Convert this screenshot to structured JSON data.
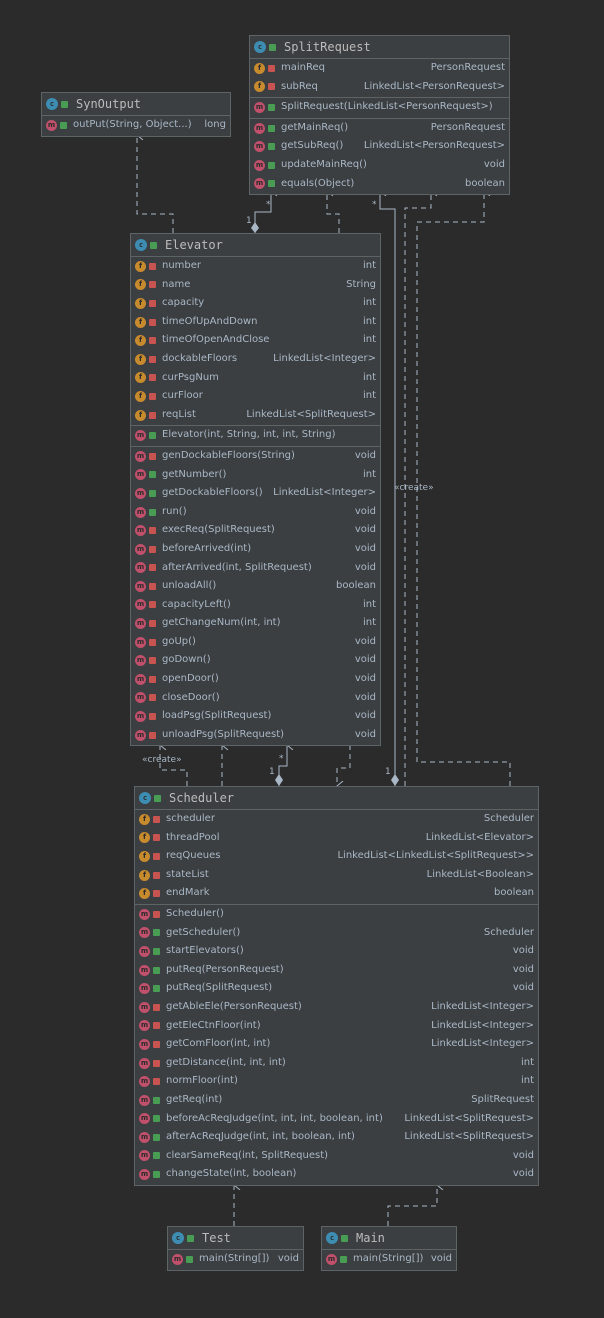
{
  "classes": {
    "splitrequest": {
      "name": "SplitRequest",
      "fields": [
        {
          "name": "mainReq",
          "type": "PersonRequest"
        },
        {
          "name": "subReq",
          "type": "LinkedList<PersonRequest>"
        }
      ],
      "constructors": [
        {
          "name": "SplitRequest(LinkedList<PersonRequest>)",
          "type": ""
        }
      ],
      "methods": [
        {
          "name": "getMainReq()",
          "type": "PersonRequest"
        },
        {
          "name": "getSubReq()",
          "type": "LinkedList<PersonRequest>"
        },
        {
          "name": "updateMainReq()",
          "type": "void"
        },
        {
          "name": "equals(Object)",
          "type": "boolean"
        }
      ]
    },
    "synoutput": {
      "name": "SynOutput",
      "methods": [
        {
          "name": "outPut(String, Object...)",
          "type": "long"
        }
      ]
    },
    "elevator": {
      "name": "Elevator",
      "fields": [
        {
          "name": "number",
          "type": "int"
        },
        {
          "name": "name",
          "type": "String"
        },
        {
          "name": "capacity",
          "type": "int"
        },
        {
          "name": "timeOfUpAndDown",
          "type": "int"
        },
        {
          "name": "timeOfOpenAndClose",
          "type": "int"
        },
        {
          "name": "dockableFloors",
          "type": "LinkedList<Integer>"
        },
        {
          "name": "curPsgNum",
          "type": "int"
        },
        {
          "name": "curFloor",
          "type": "int"
        },
        {
          "name": "reqList",
          "type": "LinkedList<SplitRequest>"
        }
      ],
      "constructors": [
        {
          "name": "Elevator(int, String, int, int, String)",
          "type": ""
        }
      ],
      "methods": [
        {
          "name": "genDockableFloors(String)",
          "type": "void"
        },
        {
          "name": "getNumber()",
          "type": "int"
        },
        {
          "name": "getDockableFloors()",
          "type": "LinkedList<Integer>"
        },
        {
          "name": "run()",
          "type": "void"
        },
        {
          "name": "execReq(SplitRequest)",
          "type": "void"
        },
        {
          "name": "beforeArrived(int)",
          "type": "void"
        },
        {
          "name": "afterArrived(int, SplitRequest)",
          "type": "void"
        },
        {
          "name": "unloadAll()",
          "type": "boolean"
        },
        {
          "name": "capacityLeft()",
          "type": "int"
        },
        {
          "name": "getChangeNum(int, int)",
          "type": "int"
        },
        {
          "name": "goUp()",
          "type": "void"
        },
        {
          "name": "goDown()",
          "type": "void"
        },
        {
          "name": "openDoor()",
          "type": "void"
        },
        {
          "name": "closeDoor()",
          "type": "void"
        },
        {
          "name": "loadPsg(SplitRequest)",
          "type": "void"
        },
        {
          "name": "unloadPsg(SplitRequest)",
          "type": "void"
        }
      ]
    },
    "scheduler": {
      "name": "Scheduler",
      "fields": [
        {
          "name": "scheduler",
          "type": "Scheduler"
        },
        {
          "name": "threadPool",
          "type": "LinkedList<Elevator>"
        },
        {
          "name": "reqQueues",
          "type": "LinkedList<LinkedList<SplitRequest>>"
        },
        {
          "name": "stateList",
          "type": "LinkedList<Boolean>"
        },
        {
          "name": "endMark",
          "type": "boolean"
        }
      ],
      "methods": [
        {
          "name": "Scheduler()",
          "type": ""
        },
        {
          "name": "getScheduler()",
          "type": "Scheduler"
        },
        {
          "name": "startElevators()",
          "type": "void"
        },
        {
          "name": "putReq(PersonRequest)",
          "type": "void"
        },
        {
          "name": "putReq(SplitRequest)",
          "type": "void"
        },
        {
          "name": "getAbleEle(PersonRequest)",
          "type": "LinkedList<Integer>"
        },
        {
          "name": "getEleCtnFloor(int)",
          "type": "LinkedList<Integer>"
        },
        {
          "name": "getComFloor(int, int)",
          "type": "LinkedList<Integer>"
        },
        {
          "name": "getDistance(int, int, int)",
          "type": "int"
        },
        {
          "name": "normFloor(int)",
          "type": "int"
        },
        {
          "name": "getReq(int)",
          "type": "SplitRequest"
        },
        {
          "name": "beforeAcReqJudge(int, int, int, boolean, int)",
          "type": "LinkedList<SplitRequest>"
        },
        {
          "name": "afterAcReqJudge(int, int, boolean, int)",
          "type": "LinkedList<SplitRequest>"
        },
        {
          "name": "clearSameReq(int, SplitRequest)",
          "type": "void"
        },
        {
          "name": "changeState(int, boolean)",
          "type": "void"
        }
      ]
    },
    "test": {
      "name": "Test",
      "methods": [
        {
          "name": "main(String[])",
          "type": "void"
        }
      ]
    },
    "main": {
      "name": "Main",
      "methods": [
        {
          "name": "main(String[])",
          "type": "void"
        }
      ]
    }
  },
  "edge_labels": {
    "create_right": "«create»",
    "create_left": "«create»",
    "mult_star": "*",
    "mult_one": "1"
  },
  "icons": {
    "class": "class-icon",
    "field": "field-icon",
    "method": "method-icon",
    "private": "private-lock-icon",
    "public": "public-open-icon"
  },
  "colors": {
    "background": "#2b2b2b",
    "box": "#3c3f41",
    "border": "#5e6366",
    "class_icon": "#3d8db3",
    "field_icon": "#c78b2e",
    "method_icon": "#c0506b",
    "private": "#c75450",
    "public": "#499c54",
    "edge": "#a9b7c6"
  }
}
